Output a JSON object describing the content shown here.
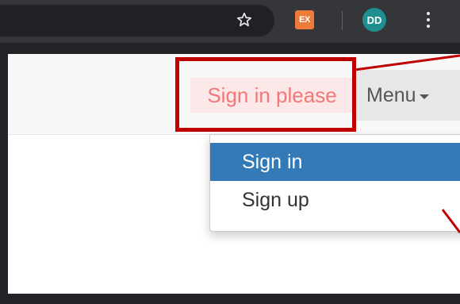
{
  "browser": {
    "extension_label": "EX",
    "profile_initials": "DD"
  },
  "navbar": {
    "signin_link": "Sign in please",
    "menu_label": "Menu"
  },
  "dropdown": {
    "items": [
      {
        "label": "Sign in",
        "active": true
      },
      {
        "label": "Sign up",
        "active": false
      }
    ]
  },
  "colors": {
    "highlight": "#c00000",
    "active_item": "#337ab7",
    "signin_text": "#f47777"
  }
}
